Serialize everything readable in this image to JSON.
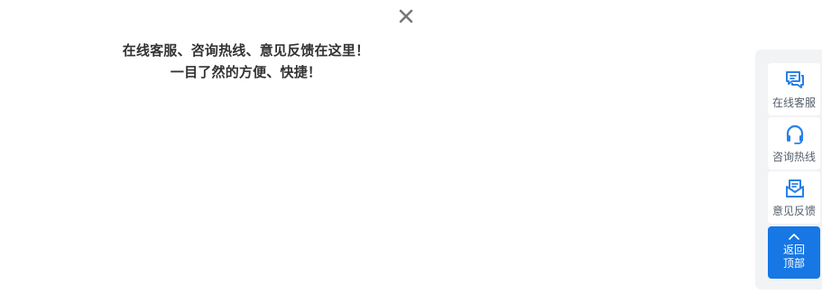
{
  "tooltip": {
    "line1": "在线客服、咨询热线、意见反馈在这里！",
    "line2": "一目了然的方便、快捷！"
  },
  "sidebar": {
    "items": [
      {
        "label": "在线客服",
        "icon": "chat-bubbles-icon"
      },
      {
        "label": "咨询热线",
        "icon": "headset-icon"
      },
      {
        "label": "意见反馈",
        "icon": "mail-envelope-icon"
      }
    ],
    "back_top": {
      "line1": "返回",
      "line2": "顶部",
      "icon": "chevron-up-icon"
    }
  },
  "colors": {
    "accent": "#1677e5",
    "icon_blue": "#2a80e8",
    "sidebar_bg": "#f2f3f5",
    "label_gray": "#555f6d",
    "tip_text": "#333333",
    "close_gray": "#777777"
  }
}
